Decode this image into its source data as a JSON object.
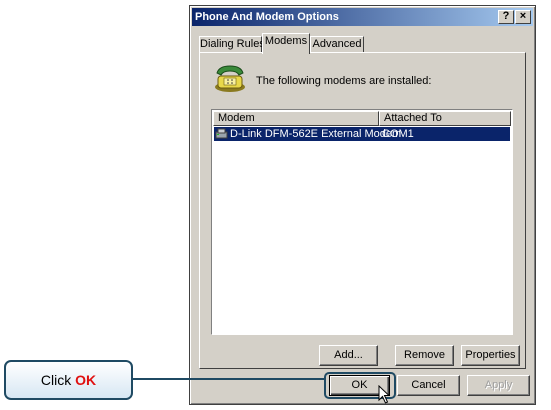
{
  "window": {
    "title": "Phone And Modem Options",
    "help_label": "?",
    "close_label": "×"
  },
  "tabs": [
    {
      "label": "Dialing Rules"
    },
    {
      "label": "Modems"
    },
    {
      "label": "Advanced"
    }
  ],
  "panel": {
    "message": "The following modems are installed:",
    "columns": [
      "Modem",
      "Attached To"
    ],
    "rows": [
      {
        "modem": "D-Link DFM-562E External Modem",
        "attached_to": "COM1"
      }
    ]
  },
  "panel_buttons": {
    "add": "Add...",
    "remove": "Remove",
    "properties": "Properties"
  },
  "dialog_buttons": {
    "ok": "OK",
    "cancel": "Cancel",
    "apply": "Apply"
  },
  "callout": {
    "prefix": "Click ",
    "emphasis": "OK"
  },
  "colors": {
    "selection": "#0a246a",
    "title_gradient_start": "#0a246a",
    "callout_border": "#1f4a63",
    "callout_emphasis": "#e01010"
  }
}
